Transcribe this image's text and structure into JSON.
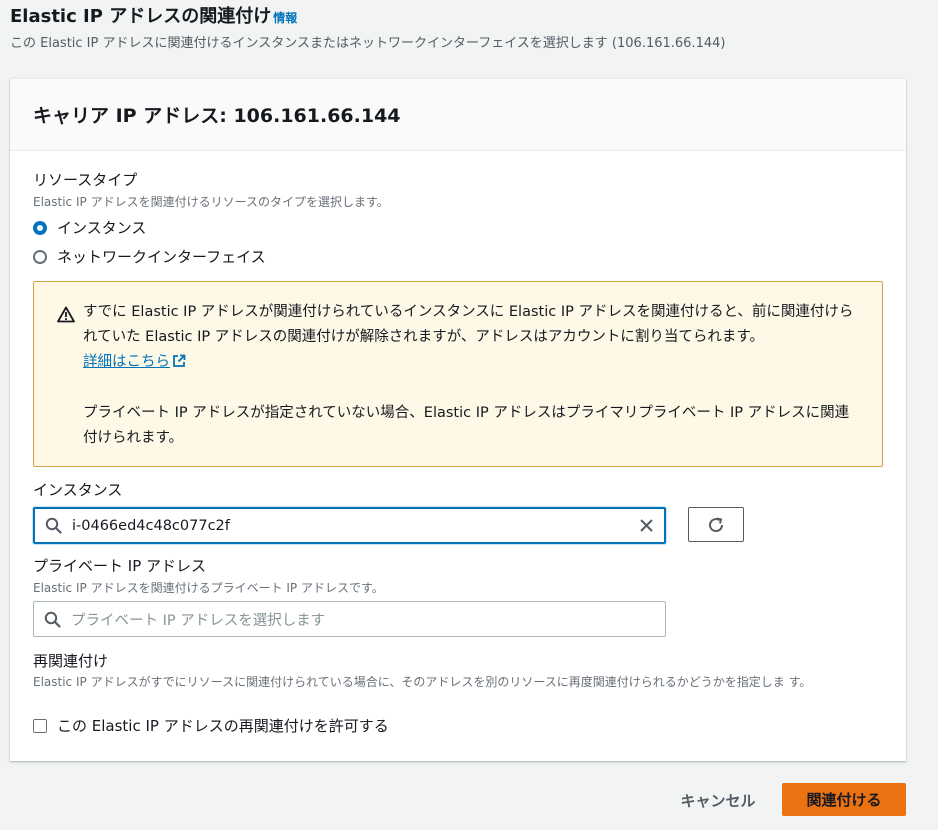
{
  "header": {
    "title": "Elastic IP アドレスの関連付け",
    "info_link": "情報",
    "description": "この Elastic IP アドレスに関連付けるインスタンスまたはネットワークインターフェイスを選択します (106.161.66.144)"
  },
  "panel": {
    "title": "キャリア IP アドレス: 106.161.66.144"
  },
  "resource_type": {
    "label": "リソースタイプ",
    "description": "Elastic IP アドレスを関連付けるリソースのタイプを選択します。",
    "options": [
      {
        "label": "インスタンス",
        "selected": true
      },
      {
        "label": "ネットワークインターフェイス",
        "selected": false
      }
    ]
  },
  "alert": {
    "text": "すでに Elastic IP アドレスが関連付けられているインスタンスに Elastic IP アドレスを関連付けると、前に関連付けられていた Elastic IP アドレスの関連付けが解除されますが、アドレスはアカウントに割り当てられます。",
    "link": "詳細はこちら",
    "note": "プライベート IP アドレスが指定されていない場合、Elastic IP アドレスはプライマリプライベート IP アドレスに関連付けられます。"
  },
  "instance": {
    "label": "インスタンス",
    "value": "i-0466ed4c48c077c2f"
  },
  "private_ip": {
    "label": "プライベート IP アドレス",
    "description": "Elastic IP アドレスを関連付けるプライベート IP アドレスです。",
    "placeholder": "プライベート IP アドレスを選択します"
  },
  "reassociation": {
    "label": "再関連付け",
    "description": "Elastic IP アドレスがすでにリソースに関連付けられている場合に、そのアドレスを別のリソースに再度関連付けられるかどうかを指定しま す。",
    "checkbox_label": "この Elastic IP アドレスの再関連付けを許可する",
    "checked": false
  },
  "footer": {
    "cancel_label": "キャンセル",
    "submit_label": "関連付ける"
  },
  "colors": {
    "accent": "#0073bb",
    "primary_button": "#ec7211",
    "warning_bg": "#fef8e7",
    "warning_border": "#d4a44a"
  }
}
